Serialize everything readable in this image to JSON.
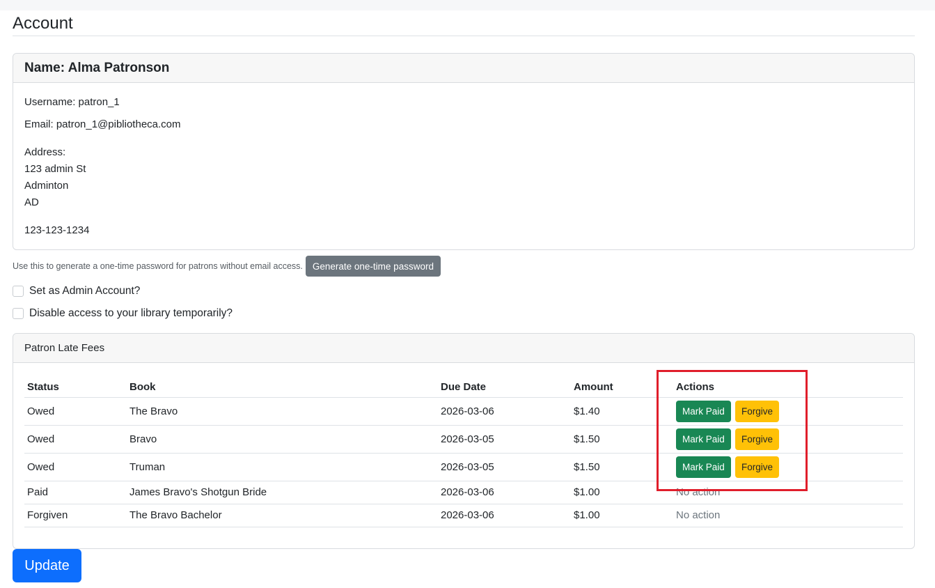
{
  "page": {
    "title": "Account"
  },
  "patron": {
    "name_line": "Name: Alma Patronson",
    "username_line": "Username: patron_1",
    "email_line": "Email: patron_1@pibliotheca.com",
    "address_label": "Address:",
    "address_lines": [
      "123 admin St",
      "Adminton",
      "AD"
    ],
    "phone": "123-123-1234"
  },
  "otp": {
    "helper_text": "Use this to generate a one-time password for patrons without email access.",
    "button_label": "Generate one-time password"
  },
  "options": {
    "admin_label": "Set as Admin Account?",
    "admin_checked": false,
    "disable_label": "Disable access to your library temporarily?",
    "disable_checked": false
  },
  "fees": {
    "header": "Patron Late Fees",
    "columns": [
      "Status",
      "Book",
      "Due Date",
      "Amount",
      "Actions"
    ],
    "mark_paid_label": "Mark Paid",
    "forgive_label": "Forgive",
    "no_action_label": "No action",
    "rows": [
      {
        "status": "Owed",
        "book": "The Bravo",
        "due": "2026-03-06",
        "amount": "$1.40",
        "has_actions": true
      },
      {
        "status": "Owed",
        "book": "Bravo",
        "due": "2026-03-05",
        "amount": "$1.50",
        "has_actions": true
      },
      {
        "status": "Owed",
        "book": "Truman",
        "due": "2026-03-05",
        "amount": "$1.50",
        "has_actions": true
      },
      {
        "status": "Paid",
        "book": "James Bravo's Shotgun Bride",
        "due": "2026-03-06",
        "amount": "$1.00",
        "has_actions": false
      },
      {
        "status": "Forgiven",
        "book": "The Bravo Bachelor",
        "due": "2026-03-06",
        "amount": "$1.00",
        "has_actions": false
      }
    ]
  },
  "update_button": "Update",
  "colors": {
    "primary": "#0d6efd",
    "success": "#198754",
    "warning": "#ffc107",
    "secondary": "#6c757d",
    "highlight": "#e01e2b"
  }
}
